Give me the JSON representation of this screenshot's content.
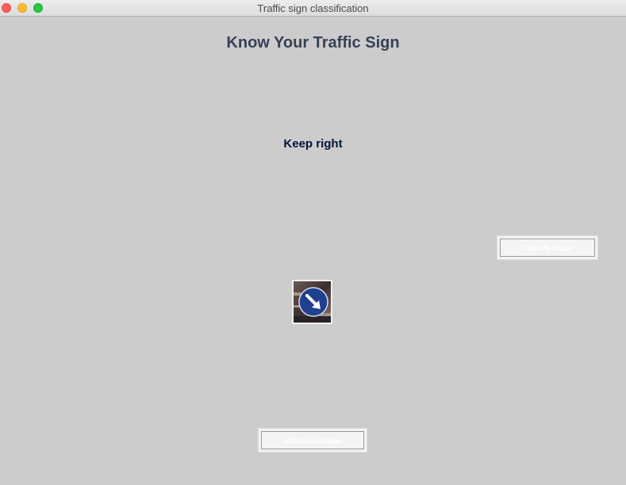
{
  "window": {
    "title": "Traffic sign classification"
  },
  "heading": "Know Your Traffic Sign",
  "result": "Keep right",
  "buttons": {
    "classify_label": "Classify Image",
    "upload_label": "Upload an image"
  },
  "image": {
    "description_icon": "keep-right-sign-icon"
  },
  "colors": {
    "background": "#cccccc",
    "heading": "#364156",
    "result": "#011638",
    "button_text": "#ffffff"
  }
}
